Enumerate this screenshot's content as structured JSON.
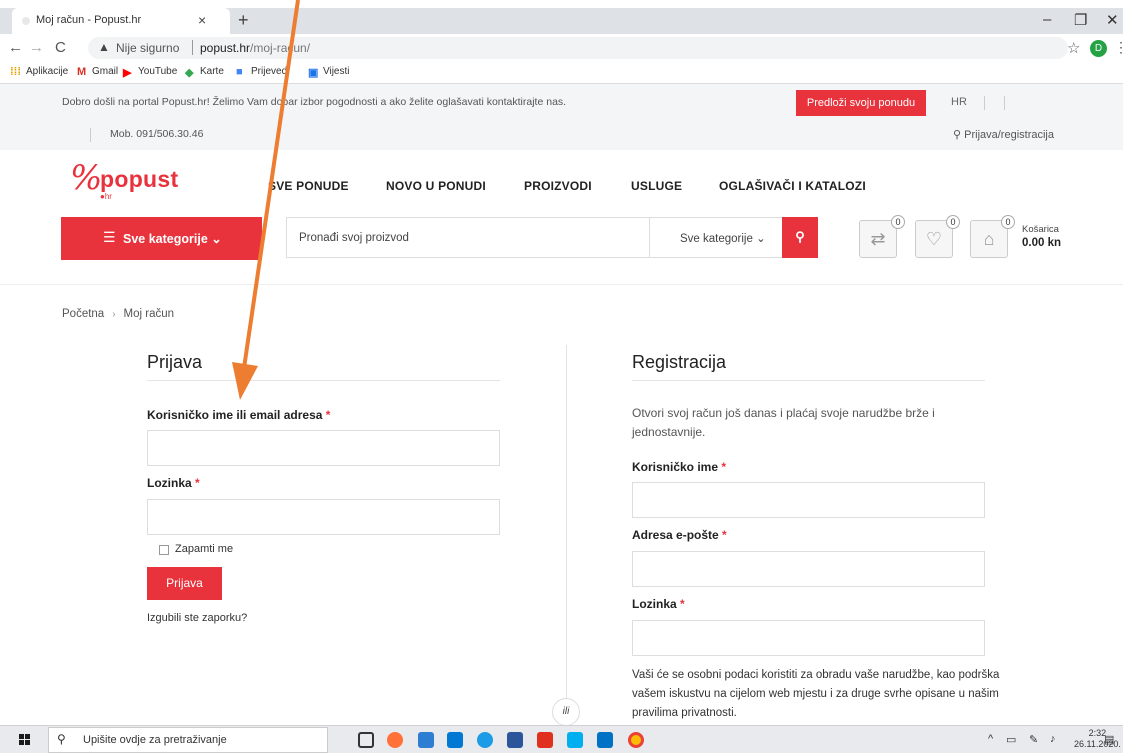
{
  "browser": {
    "tab_title": "Moj račun - Popust.hr",
    "tab_close": "×",
    "new_tab": "+",
    "insecure_label": "Nije sigurno",
    "url_host": "popust.hr",
    "url_path": "/moj-racun/",
    "profile_initial": "D",
    "window_controls": {
      "minimize": "–",
      "restore": "❐",
      "close": "✕"
    }
  },
  "bookmarks": [
    {
      "label": "Aplikacije",
      "icon": "apps-grid-icon",
      "color": "#e8323c"
    },
    {
      "label": "Gmail",
      "icon": "gmail-icon",
      "color": "#d93025"
    },
    {
      "label": "YouTube",
      "icon": "youtube-icon",
      "color": "#ff0000"
    },
    {
      "label": "Karte",
      "icon": "maps-icon",
      "color": "#34a853"
    },
    {
      "label": "Prijevedi",
      "icon": "translate-icon",
      "color": "#4285f4"
    },
    {
      "label": "Vijesti",
      "icon": "news-icon",
      "color": "#1a73e8"
    }
  ],
  "topbar": {
    "welcome": "Dobro došli na portal Popust.hr! Želimo Vam dobar izbor pogodnosti a ako želite oglašavati kontaktirajte nas.",
    "offer_button": "Predloži svoju ponudu",
    "language": "HR",
    "phone": "Mob. 091/506.30.46",
    "login_link": "Prijava/registracija"
  },
  "header": {
    "logo_word": "popust",
    "logo_suffix": "hr",
    "nav": [
      "SVE PONUDE",
      "NOVO U PONUDI",
      "PROIZVODI",
      "USLUGE",
      "OGLAŠIVAČI I KATALOZI"
    ],
    "categories_button": "Sve kategorije",
    "search_placeholder": "Pronađi svoj proizvod",
    "search_category": "Sve kategorije",
    "compare_count": "0",
    "wishlist_count": "0",
    "cart_count": "0",
    "cart_label": "Košarica",
    "cart_total": "0.00 kn",
    "accent_color": "#e8323c"
  },
  "breadcrumb": {
    "home": "Početna",
    "separator": "›",
    "current": "Moj račun"
  },
  "login": {
    "title": "Prijava",
    "username_label": "Korisničko ime ili email adresa",
    "password_label": "Lozinka",
    "required_mark": "*",
    "remember_label": "Zapamti me",
    "submit_label": "Prijava",
    "lost_password": "Izgubili ste zaporku?"
  },
  "register": {
    "title": "Registracija",
    "intro": "Otvori svoj račun još danas i plaćaj svoje narudžbe brže i jednostavnije.",
    "username_label": "Korisničko ime",
    "email_label": "Adresa e-pošte",
    "password_label": "Lozinka",
    "privacy_text": "Vaši će se osobni podaci koristiti za obradu vaše narudžbe, kao podrška vašem iskustvu na cijelom web mjestu i za druge svrhe opisane u našim pravilima privatnosti."
  },
  "or_label": "ili",
  "taskbar": {
    "search_placeholder": "Upišite ovdje za pretraživanje",
    "time": "2:32",
    "date": "26.11.2020."
  }
}
